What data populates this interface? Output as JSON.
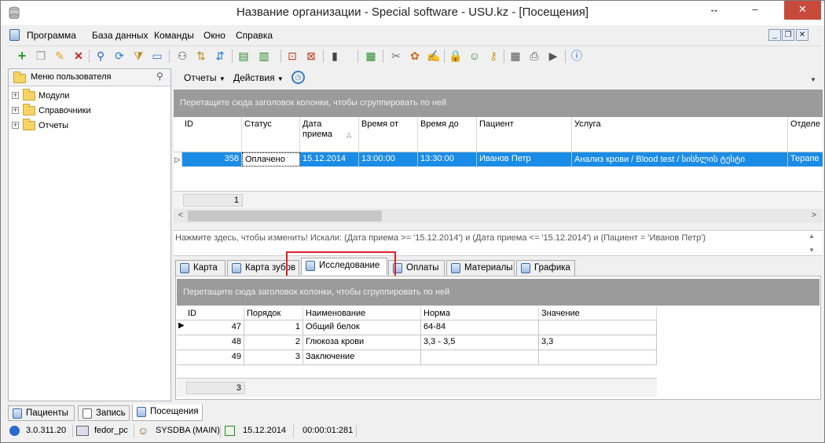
{
  "window": {
    "title": "Название организации - Special software - USU.kz - [Посещения]",
    "minimize": "–",
    "restore": "↔",
    "maximize": "□",
    "close": "✕"
  },
  "menu": [
    "Программа",
    "База данных",
    "Команды",
    "Окно",
    "Справка"
  ],
  "left_panel": {
    "title": "Меню пользователя",
    "tree": [
      "Модули",
      "Справочники",
      "Отчеты"
    ]
  },
  "subtoolbar": {
    "reports": "Отчеты",
    "actions": "Действия"
  },
  "group_hint": "Перетащите сюда заголовок колонки, чтобы сгруппировать по ней",
  "visits_grid": {
    "columns": [
      "ID",
      "Статус",
      "Дата приема",
      "Время от",
      "Время до",
      "Пациент",
      "Услуга",
      "Отделе"
    ],
    "rows": [
      [
        "358",
        "Оплачено",
        "15.12.2014",
        "13:00:00",
        "13:30:00",
        "Иванов Петр",
        "Анализ крови / Blood test / სისხლის ტესტი",
        "Терапе"
      ]
    ],
    "footer_count": "1"
  },
  "filter_text": "Нажмите здесь, чтобы изменить! Искали: (Дата приема  >= '15.12.2014') и (Дата приема  <= '15.12.2014') и (Пациент = 'Иванов Петр')",
  "tabs": [
    "Карта",
    "Карта зубов",
    "Исследование",
    "Оплаты",
    "Материалы",
    "Графика"
  ],
  "active_tab": "Исследование",
  "research_grid": {
    "group_hint": "Перетащите сюда заголовок колонки, чтобы сгруппировать по ней",
    "columns": [
      "ID",
      "Порядок",
      "Наименование",
      "Норма",
      "Значение"
    ],
    "rows": [
      [
        "47",
        "1",
        "Общий белок",
        "64-84",
        ""
      ],
      [
        "48",
        "2",
        "Глюкоза крови",
        "3,3 - 3,5",
        "3,3"
      ],
      [
        "49",
        "3",
        "Заключение",
        "",
        ""
      ]
    ],
    "footer_count": "3"
  },
  "bottom_tabs": [
    "Пациенты",
    "Запись",
    "Посещения"
  ],
  "status": {
    "version": "3.0.311.20",
    "host": "fedor_pc",
    "user": "SYSDBA (MAIN)",
    "date": "15.12.2014",
    "timer": "00:00:01:281"
  },
  "colors": {
    "selection": "#1a8ce6",
    "group_panel": "#9b9b9b",
    "highlight_box": "#e0202a"
  }
}
